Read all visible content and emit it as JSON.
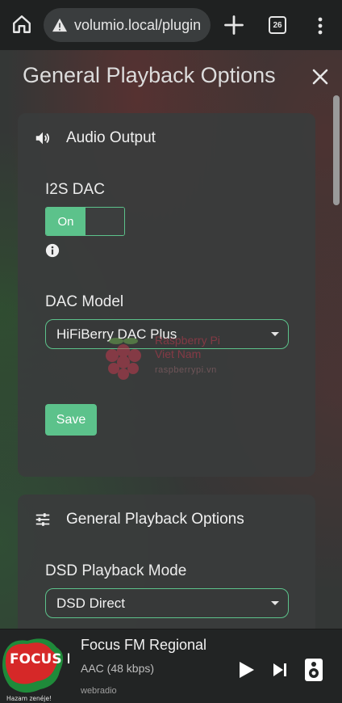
{
  "browser": {
    "url": "volumio.local/plugin",
    "tab_count": "26"
  },
  "page": {
    "title": "General Playback Options"
  },
  "audio_output": {
    "header": "Audio Output",
    "i2s_label": "I2S DAC",
    "toggle_on_label": "On",
    "toggle_state": true,
    "dac_model_label": "DAC Model",
    "dac_model_value": "HiFiBerry DAC Plus",
    "save_label": "Save"
  },
  "general_playback": {
    "header": "General Playback Options",
    "dsd_label": "DSD Playback Mode",
    "dsd_value": "DSD Direct"
  },
  "watermark": {
    "line1": "Raspberry Pi",
    "line2": "Viet Nam",
    "line3": "raspberrypi.vn"
  },
  "player": {
    "title": "Focus FM Regional",
    "format": "AAC (48 kbps)",
    "source": "webradio",
    "art_logo": "FOCUS FM",
    "art_caption": "Hazam zenéje!"
  },
  "colors": {
    "accent": "#5cc28b",
    "card": "#3a3c3c",
    "background": "#343736"
  },
  "icons": [
    "home-icon",
    "warning-icon",
    "plus-icon",
    "tabs-icon",
    "more-vert-icon",
    "close-icon",
    "volume-icon",
    "info-icon",
    "sliders-icon",
    "play-icon",
    "skip-next-icon",
    "speaker-icon"
  ]
}
